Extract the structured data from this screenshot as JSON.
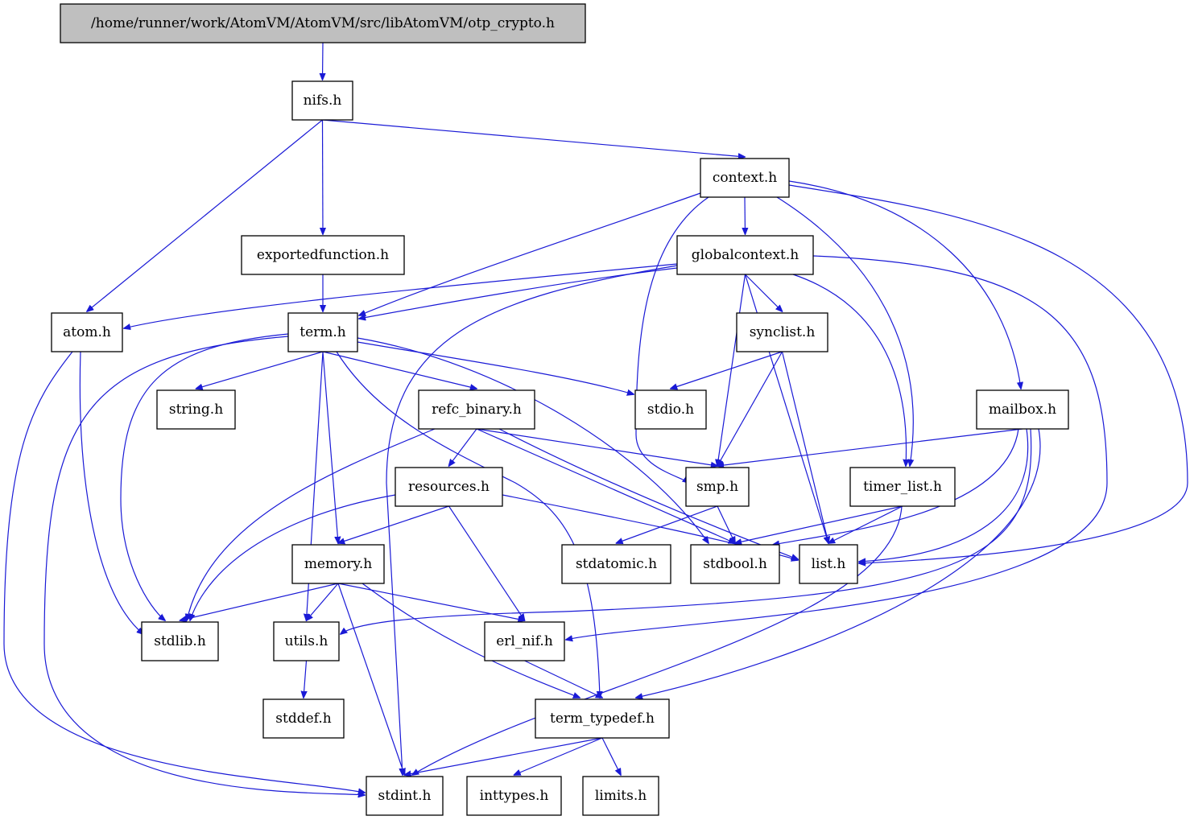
{
  "colors": {
    "edge": "#1a1ad6",
    "root_fill": "#bfbfbf",
    "node_fill": "#ffffff"
  },
  "nodes": {
    "root": "/home/runner/work/AtomVM/AtomVM/src/libAtomVM/otp_crypto.h",
    "nifs": "nifs.h",
    "context": "context.h",
    "exportedfunction": "exportedfunction.h",
    "globalcontext": "globalcontext.h",
    "atom": "atom.h",
    "term": "term.h",
    "synclist": "synclist.h",
    "string": "string.h",
    "refc_binary": "refc_binary.h",
    "stdio": "stdio.h",
    "mailbox": "mailbox.h",
    "resources": "resources.h",
    "smp": "smp.h",
    "timer_list": "timer_list.h",
    "memory": "memory.h",
    "stdatomic": "stdatomic.h",
    "stdbool": "stdbool.h",
    "list": "list.h",
    "stdlib": "stdlib.h",
    "utils": "utils.h",
    "erl_nif": "erl_nif.h",
    "stddef": "stddef.h",
    "term_typedef": "term_typedef.h",
    "stdint": "stdint.h",
    "inttypes": "inttypes.h",
    "limits": "limits.h"
  },
  "edges": [
    [
      "root",
      "nifs"
    ],
    [
      "nifs",
      "context"
    ],
    [
      "nifs",
      "exportedfunction"
    ],
    [
      "nifs",
      "atom"
    ],
    [
      "context",
      "globalcontext"
    ],
    [
      "context",
      "term"
    ],
    [
      "context",
      "smp"
    ],
    [
      "context",
      "timer_list"
    ],
    [
      "context",
      "mailbox"
    ],
    [
      "context",
      "list"
    ],
    [
      "exportedfunction",
      "term"
    ],
    [
      "globalcontext",
      "atom"
    ],
    [
      "globalcontext",
      "term"
    ],
    [
      "globalcontext",
      "synclist"
    ],
    [
      "globalcontext",
      "smp"
    ],
    [
      "globalcontext",
      "list"
    ],
    [
      "globalcontext",
      "timer_list"
    ],
    [
      "globalcontext",
      "stdint"
    ],
    [
      "globalcontext",
      "erl_nif"
    ],
    [
      "atom",
      "stdlib"
    ],
    [
      "atom",
      "stdint"
    ],
    [
      "term",
      "string"
    ],
    [
      "term",
      "refc_binary"
    ],
    [
      "term",
      "stdio"
    ],
    [
      "term",
      "memory"
    ],
    [
      "term",
      "utils"
    ],
    [
      "term",
      "stdlib"
    ],
    [
      "term",
      "stdint"
    ],
    [
      "term",
      "stdbool"
    ],
    [
      "term",
      "term_typedef"
    ],
    [
      "synclist",
      "stdio"
    ],
    [
      "synclist",
      "smp"
    ],
    [
      "synclist",
      "list"
    ],
    [
      "refc_binary",
      "resources"
    ],
    [
      "refc_binary",
      "smp"
    ],
    [
      "refc_binary",
      "stdbool"
    ],
    [
      "refc_binary",
      "list"
    ],
    [
      "refc_binary",
      "stdlib"
    ],
    [
      "mailbox",
      "smp"
    ],
    [
      "mailbox",
      "stdbool"
    ],
    [
      "mailbox",
      "list"
    ],
    [
      "mailbox",
      "utils"
    ],
    [
      "mailbox",
      "term_typedef"
    ],
    [
      "resources",
      "memory"
    ],
    [
      "resources",
      "erl_nif"
    ],
    [
      "resources",
      "stdlib"
    ],
    [
      "resources",
      "list"
    ],
    [
      "smp",
      "stdatomic"
    ],
    [
      "smp",
      "stdbool"
    ],
    [
      "timer_list",
      "stdbool"
    ],
    [
      "timer_list",
      "list"
    ],
    [
      "timer_list",
      "stdint"
    ],
    [
      "memory",
      "stdlib"
    ],
    [
      "memory",
      "utils"
    ],
    [
      "memory",
      "erl_nif"
    ],
    [
      "memory",
      "stdint"
    ],
    [
      "memory",
      "term_typedef"
    ],
    [
      "utils",
      "stddef"
    ],
    [
      "erl_nif",
      "term_typedef"
    ],
    [
      "term_typedef",
      "stdint"
    ],
    [
      "term_typedef",
      "inttypes"
    ],
    [
      "term_typedef",
      "limits"
    ]
  ]
}
